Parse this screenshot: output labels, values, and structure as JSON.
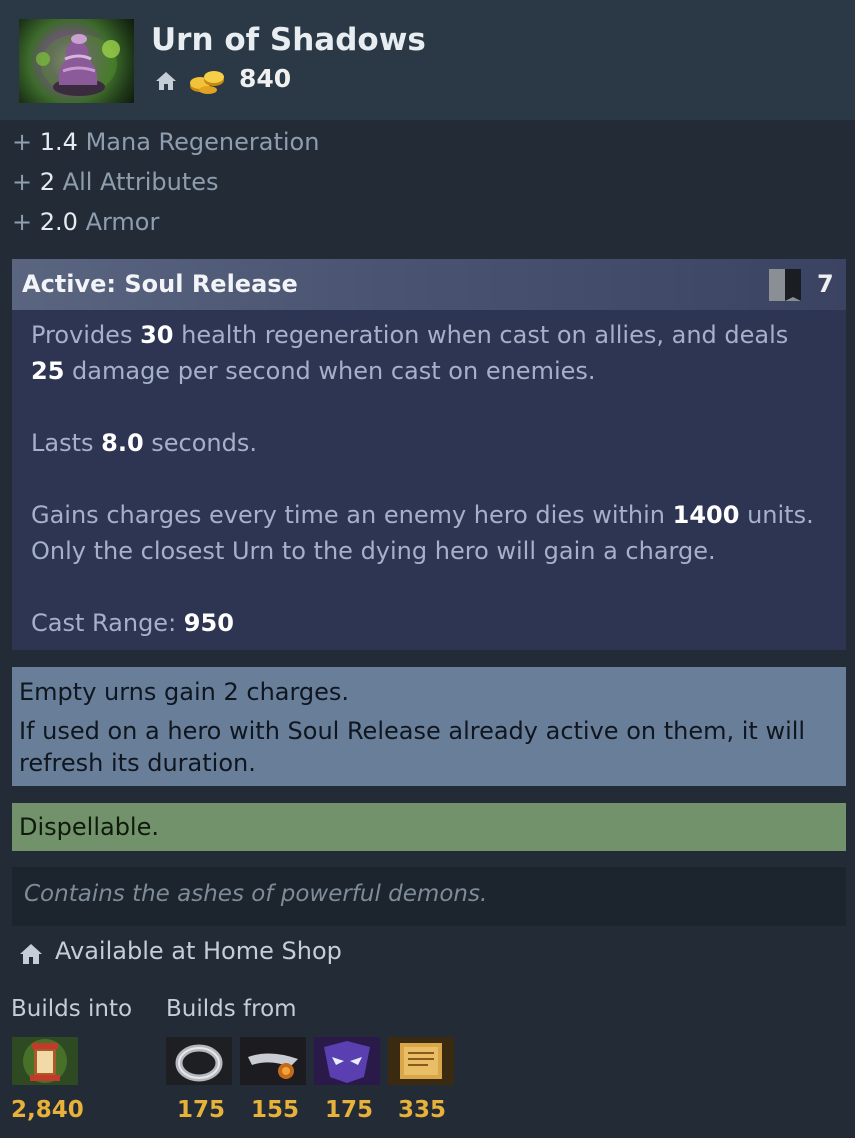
{
  "item": {
    "name": "Urn of Shadows",
    "icon": "urn-of-shadows-icon",
    "cost": "840"
  },
  "attributes": [
    {
      "plus": "+",
      "value": "1.4",
      "label": "Mana Regeneration"
    },
    {
      "plus": "+",
      "value": "2",
      "label": "All Attributes"
    },
    {
      "plus": "+",
      "value": "2.0",
      "label": "Armor"
    }
  ],
  "active": {
    "title": "Active: Soul Release",
    "cooldown": "7",
    "lines": {
      "l1a": "Provides ",
      "l1b": "30",
      "l1c": " health regeneration when cast on allies, and deals",
      "l2a": "25",
      "l2b": " damage per second when cast on enemies.",
      "l3a": "Lasts ",
      "l3b": "8.0",
      "l3c": " seconds.",
      "l4a": "Gains charges every time an enemy hero dies within ",
      "l4b": "1400",
      "l4c": " units.",
      "l5": "Only the closest Urn to the dying hero will gain a charge.",
      "l6a": "Cast Range: ",
      "l6b": "950"
    }
  },
  "notes": {
    "n1": "Empty urns gain 2 charges.",
    "n2": "If used on a hero with Soul Release already active on them, it will",
    "n3": "refresh its duration."
  },
  "dispel": "Dispellable.",
  "lore": "Contains the ashes of powerful demons.",
  "availability": "Available at Home Shop",
  "builds_into": {
    "label": "Builds into",
    "items": [
      {
        "icon": "spirit-vessel-icon",
        "price": "2,840"
      }
    ]
  },
  "builds_from": {
    "label": "Builds from",
    "items": [
      {
        "icon": "ring-of-protection-icon",
        "price": "175"
      },
      {
        "icon": "sages-mask-icon",
        "price": "155"
      },
      {
        "icon": "circlet-icon",
        "price": "175"
      },
      {
        "icon": "recipe-scroll-icon",
        "price": "335"
      }
    ]
  },
  "colors": {
    "background": "#232c36",
    "header": "#2b3946",
    "active_box": "#2e3552",
    "note_box": "#697f99",
    "dispel_box": "#71926a",
    "gold": "#e8b23a"
  }
}
